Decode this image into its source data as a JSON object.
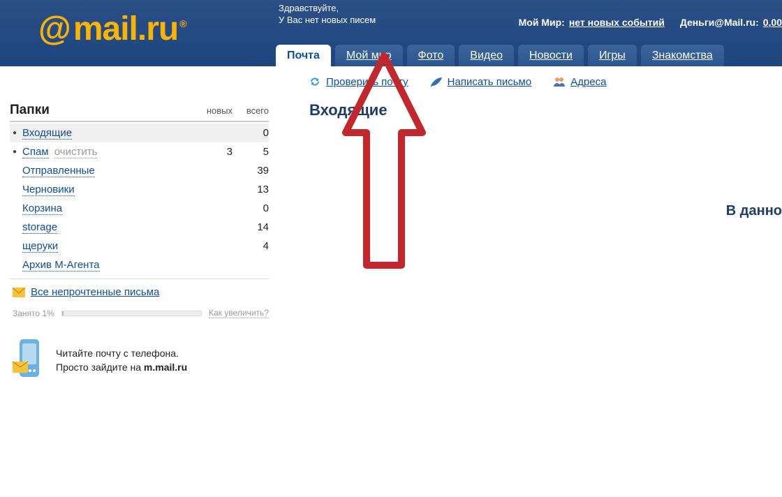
{
  "logo": {
    "text": "mail.ru"
  },
  "greeting": {
    "line1": "Здравствуйте,",
    "line2": "У Вас нет новых писем"
  },
  "top_links": {
    "moy_mir_label": "Мой Мир:",
    "moy_mir_value": "нет новых событий",
    "money_label": "Деньги@Mail.ru:",
    "money_value": "0,00"
  },
  "tabs": [
    {
      "label": "Почта",
      "active": true
    },
    {
      "label": "Мой мир",
      "active": false
    },
    {
      "label": "Фото",
      "active": false
    },
    {
      "label": "Видео",
      "active": false
    },
    {
      "label": "Новости",
      "active": false
    },
    {
      "label": "Игры",
      "active": false
    },
    {
      "label": "Знакомства",
      "active": false
    }
  ],
  "actions": {
    "check_mail": "Проверить почту",
    "compose": "Написать письмо",
    "contacts": "Адреса"
  },
  "sidebar": {
    "title": "Папки",
    "col_new": "новых",
    "col_total": "всего",
    "folders": [
      {
        "name": "Входящие",
        "new": "",
        "total": "0",
        "bullet": true,
        "selected": true,
        "extra": ""
      },
      {
        "name": "Спам",
        "new": "3",
        "total": "5",
        "bullet": true,
        "selected": false,
        "extra": "очистить"
      },
      {
        "name": "Отправленные",
        "new": "",
        "total": "39",
        "bullet": false,
        "selected": false,
        "extra": ""
      },
      {
        "name": "Черновики",
        "new": "",
        "total": "13",
        "bullet": false,
        "selected": false,
        "extra": ""
      },
      {
        "name": "Корзина",
        "new": "",
        "total": "0",
        "bullet": false,
        "selected": false,
        "extra": ""
      },
      {
        "name": "storage",
        "new": "",
        "total": "14",
        "bullet": false,
        "selected": false,
        "extra": ""
      },
      {
        "name": "щеруки",
        "new": "",
        "total": "4",
        "bullet": false,
        "selected": false,
        "extra": ""
      },
      {
        "name": "Архив М-Агента",
        "new": "",
        "total": "",
        "bullet": false,
        "selected": false,
        "extra": ""
      }
    ],
    "unread_link": "Все непрочтенные письма",
    "storage_used": "Занято 1%",
    "storage_how": "Как увеличить?",
    "storage_pct": "1%"
  },
  "promo": {
    "line1": "Читайте почту с телефона.",
    "line2_a": "Просто зайдите на ",
    "line2_b": "m.mail.ru"
  },
  "content": {
    "heading": "Входящие",
    "body_fragment": "В данно"
  }
}
